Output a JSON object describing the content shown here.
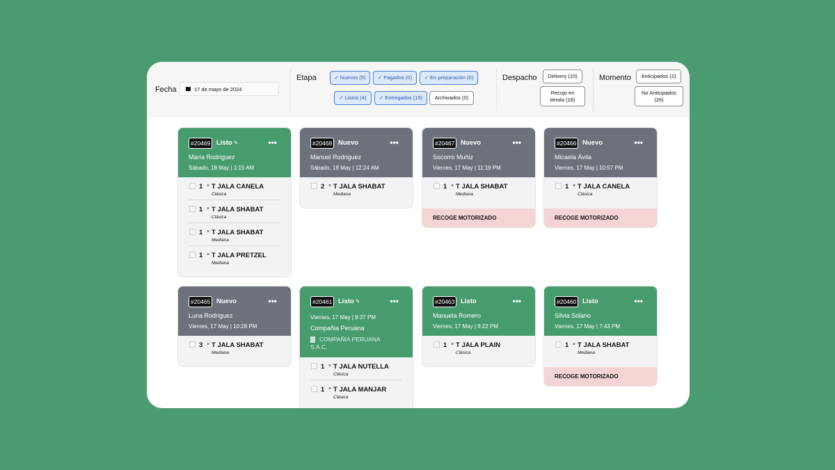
{
  "filters": {
    "fecha": {
      "label": "Fecha",
      "value": "17 de mayo de 2024",
      "icon": "calendar-icon"
    },
    "etapa": {
      "label": "Etapa",
      "chips": [
        {
          "label": "Nuevos (5)",
          "selected": true
        },
        {
          "label": "Pagados (0)",
          "selected": true
        },
        {
          "label": "En preparación (0)",
          "selected": true
        },
        {
          "label": "Listos (4)",
          "selected": true
        },
        {
          "label": "Entregados (19)",
          "selected": true
        },
        {
          "label": "Archivados (0)",
          "selected": false
        }
      ]
    },
    "despacho": {
      "label": "Despacho",
      "chips": [
        {
          "label": "Delivery (10)",
          "selected": false
        },
        {
          "label": "Recojo en tienda (18)",
          "selected": false
        }
      ]
    },
    "momento": {
      "label": "Momento",
      "chips": [
        {
          "label": "Anticipados (2)",
          "selected": false
        },
        {
          "label": "No Anticipados (26)",
          "selected": false
        }
      ]
    }
  },
  "orders": [
    {
      "id": "#20469",
      "status": "Listo",
      "editable": true,
      "color": "#479c6e",
      "customer": "María Rodriguez",
      "date": "Sábado, 18 May | 1:15 AM",
      "items": [
        {
          "qty": "1",
          "name": "T JALA CANELA",
          "variant": "Clásica"
        },
        {
          "qty": "1",
          "name": "T JALA SHABAT",
          "variant": "Clásica"
        },
        {
          "qty": "1",
          "name": "T JALA SHABAT",
          "variant": "Mediana"
        },
        {
          "qty": "1",
          "name": "T JALA PRETZEL",
          "variant": "Mediana"
        }
      ],
      "pickup": ""
    },
    {
      "id": "#20468",
      "status": "Nuevo",
      "editable": false,
      "color": "#6c717c",
      "customer": "Manuel Rodriguez",
      "date": "Sábado, 18 May | 12:24 AM",
      "items": [
        {
          "qty": "2",
          "name": "T JALA SHABAT",
          "variant": "Mediana"
        }
      ],
      "pickup": ""
    },
    {
      "id": "#20467",
      "status": "Nuevo",
      "editable": false,
      "color": "#6c717c",
      "customer": "Socorro Muñiz",
      "date": "Viernes, 17 May | 11:19 PM",
      "items": [
        {
          "qty": "1",
          "name": "T JALA SHABAT",
          "variant": "Mediana"
        }
      ],
      "pickup": "RECOGE MOTORIZADO"
    },
    {
      "id": "#20466",
      "status": "Nuevo",
      "editable": false,
      "color": "#6c717c",
      "customer": "Micaela Ávila",
      "date": "Viernes, 17 May | 10:57 PM",
      "items": [
        {
          "qty": "1",
          "name": "T JALA CANELA",
          "variant": "Clásica"
        }
      ],
      "pickup": "RECOGE MOTORIZADO"
    },
    {
      "id": "#20465",
      "status": "Nuevo",
      "editable": false,
      "color": "#6c717c",
      "customer": "Luna Rodriguez",
      "date": "Viernes, 17 May | 10:28 PM",
      "items": [
        {
          "qty": "3",
          "name": "T JALA SHABAT",
          "variant": "Mediana"
        }
      ],
      "pickup": ""
    },
    {
      "id": "#20461",
      "status": "Listo",
      "editable": true,
      "color": "#479c6e",
      "customer": "Compañia Peruana",
      "date": "Viernes, 17 May | 9:37 PM",
      "company": "COMPAÑIA PERUANA S.A.C.",
      "items": [
        {
          "qty": "1",
          "name": "T JALA NUTELLA",
          "variant": "Clásica"
        },
        {
          "qty": "1",
          "name": "T JALA MANJAR",
          "variant": "Clásica"
        }
      ],
      "pickup": ""
    },
    {
      "id": "#20463",
      "status": "Listo",
      "editable": false,
      "color": "#479c6e",
      "customer": "Manuela Romero",
      "date": "Viernes, 17 May | 9:22 PM",
      "items": [
        {
          "qty": "1",
          "name": "T JALA PLAIN",
          "variant": "Clásica"
        }
      ],
      "pickup": ""
    },
    {
      "id": "#20460",
      "status": "Listo",
      "editable": false,
      "color": "#479c6e",
      "customer": "Silvia Solano",
      "date": "Viernes, 17 May | 7:43 PM",
      "items": [
        {
          "qty": "1",
          "name": "T JALA SHABAT",
          "variant": "Mediana"
        }
      ],
      "pickup": "RECOGE MOTORIZADO"
    }
  ]
}
